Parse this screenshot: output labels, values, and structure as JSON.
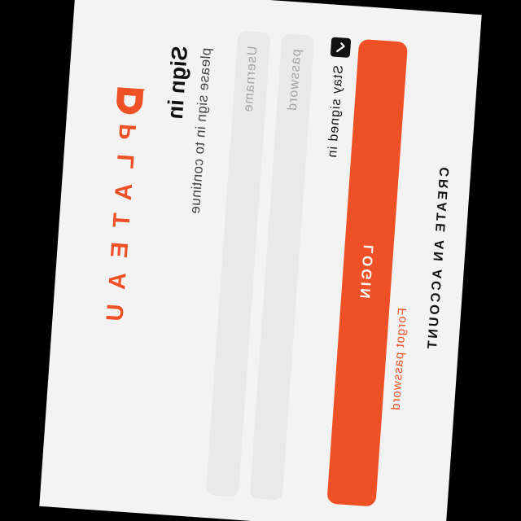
{
  "brand": {
    "name": "PLATEAU",
    "logo_icon": "plateau-logo-icon",
    "color": "#f05025"
  },
  "header": {
    "title": "Sign in",
    "subtitle": "please sign in to continue"
  },
  "form": {
    "username_placeholder": "Username",
    "username_value": "",
    "password_placeholder": "password",
    "password_value": "",
    "stay_signed_in_label": "Stay signed in",
    "stay_signed_in_checked": true,
    "checkbox_icon": "check-icon",
    "login_label": "LOGIN",
    "forgot_password_label": "Forgot password"
  },
  "footer": {
    "create_account_label": "CREATE AN ACCOUNT"
  },
  "colors": {
    "accent": "#f05025",
    "background": "#f3f3f3",
    "field_background": "#e9e9e9",
    "text": "#111111"
  }
}
